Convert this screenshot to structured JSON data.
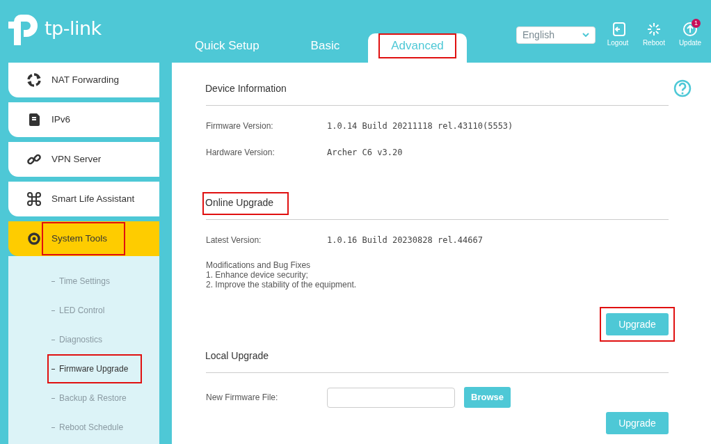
{
  "header": {
    "logo_text": "tp-link",
    "tabs": [
      {
        "label": "Quick Setup",
        "selected": false,
        "highlighted": false
      },
      {
        "label": "Basic",
        "selected": false,
        "highlighted": false
      },
      {
        "label": "Advanced",
        "selected": true,
        "highlighted": true
      }
    ],
    "language": {
      "value": "English"
    },
    "actions": [
      {
        "kind": "logout",
        "label": "Logout"
      },
      {
        "kind": "reboot",
        "label": "Reboot"
      },
      {
        "kind": "update",
        "label": "Update",
        "badge": "1"
      }
    ]
  },
  "sidebar": {
    "items": [
      {
        "kind": "nat",
        "label": "NAT Forwarding",
        "selected": false,
        "highlighted": false
      },
      {
        "kind": "ipv6",
        "label": "IPv6",
        "selected": false,
        "highlighted": false
      },
      {
        "kind": "vpn",
        "label": "VPN Server",
        "selected": false,
        "highlighted": false
      },
      {
        "kind": "smart",
        "label": "Smart Life Assistant",
        "selected": false,
        "highlighted": false
      },
      {
        "kind": "tools",
        "label": "System Tools",
        "selected": true,
        "highlighted": true,
        "children": [
          {
            "label": "Time Settings",
            "selected": false,
            "highlighted": false
          },
          {
            "label": "LED Control",
            "selected": false,
            "highlighted": false
          },
          {
            "label": "Diagnostics",
            "selected": false,
            "highlighted": false
          },
          {
            "label": "Firmware Upgrade",
            "selected": true,
            "highlighted": true
          },
          {
            "label": "Backup & Restore",
            "selected": false,
            "highlighted": false
          },
          {
            "label": "Reboot Schedule",
            "selected": false,
            "highlighted": false
          }
        ]
      }
    ]
  },
  "sections": [
    {
      "title": "Device Information",
      "highlighted": false,
      "fields": [
        {
          "label": "Firmware Version:",
          "value": "1.0.14 Build 20211118 rel.43110(5553)"
        },
        {
          "label": "Hardware Version:",
          "value": "Archer C6 v3.20"
        }
      ]
    },
    {
      "title": "Online Upgrade",
      "highlighted": true,
      "fields": [
        {
          "label": "Latest Version:",
          "value": "1.0.16 Build 20230828 rel.44667"
        }
      ],
      "notes": [
        "Modifications and Bug Fixes",
        "1. Enhance device security;",
        "2. Improve the stability of the equipment."
      ],
      "button": {
        "label": "Upgrade",
        "highlighted": true
      }
    },
    {
      "title": "Local Upgrade",
      "highlighted": false,
      "file_field": {
        "label": "New Firmware File:",
        "browse": "Browse"
      },
      "button": {
        "label": "Upgrade",
        "highlighted": false
      }
    }
  ]
}
